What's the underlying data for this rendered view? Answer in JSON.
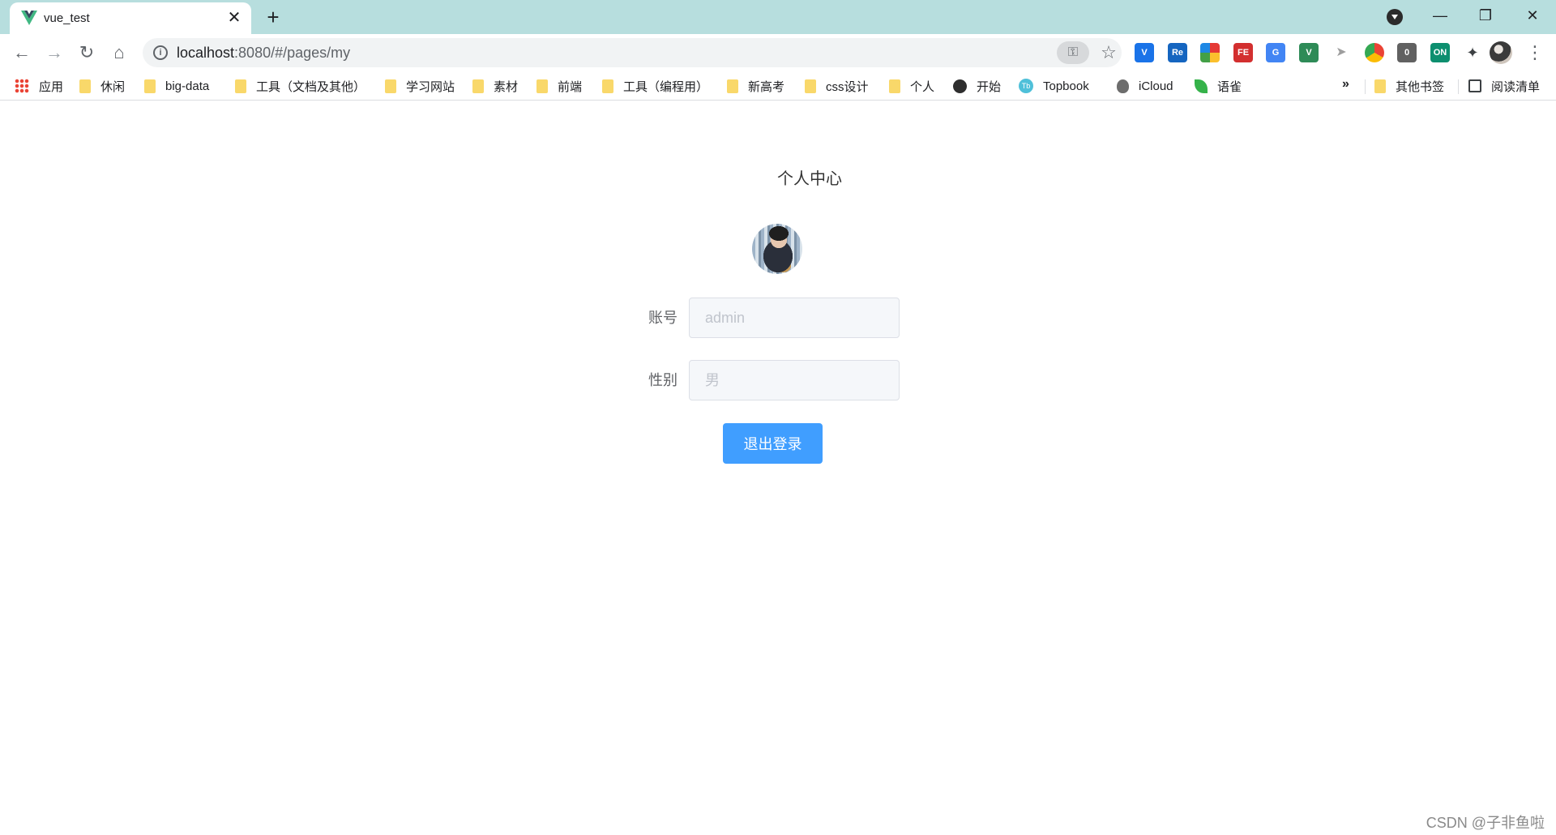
{
  "browser": {
    "tab": {
      "title": "vue_test",
      "close_glyph": "✕"
    },
    "new_tab_glyph": "+",
    "window_controls": {
      "minimize": "—",
      "maximize": "❐",
      "close": "✕"
    },
    "nav": {
      "back": "←",
      "forward": "→",
      "reload": "↻",
      "home": "⌂"
    },
    "address": {
      "host": "localhost",
      "path": ":8080/#/pages/my"
    },
    "bookmarks": [
      {
        "label": "应用",
        "icon": "apps-icon"
      },
      {
        "label": "休闲",
        "icon": "folder-icon"
      },
      {
        "label": "big-data",
        "icon": "folder-icon"
      },
      {
        "label": "工具（文档及其他）",
        "icon": "folder-icon"
      },
      {
        "label": "学习网站",
        "icon": "folder-icon"
      },
      {
        "label": "素材",
        "icon": "folder-icon"
      },
      {
        "label": "前端",
        "icon": "folder-icon"
      },
      {
        "label": "工具（编程用）",
        "icon": "folder-icon"
      },
      {
        "label": "新高考",
        "icon": "folder-icon"
      },
      {
        "label": "css设计",
        "icon": "folder-icon"
      },
      {
        "label": "个人",
        "icon": "folder-icon"
      },
      {
        "label": "开始",
        "icon": "globe-icon"
      },
      {
        "label": "Topbook",
        "icon": "topbook-icon"
      },
      {
        "label": "iCloud",
        "icon": "apple-icon"
      },
      {
        "label": "语雀",
        "icon": "yuque-icon"
      }
    ],
    "bookmarks_overflow": "»",
    "other_bookmarks": "其他书签",
    "reading_list": "阅读清单",
    "extensions": [
      {
        "name": "vue-devtools-icon",
        "text": "V",
        "color": "#1a73e8"
      },
      {
        "name": "regex-icon",
        "text": "Re",
        "color": "#1565c0"
      },
      {
        "name": "color-grid-icon",
        "text": "",
        "color": "#e53935"
      },
      {
        "name": "fe-helper-icon",
        "text": "FE",
        "color": "#d32f2f"
      },
      {
        "name": "translate-icon",
        "text": "G",
        "color": "#4285f4"
      },
      {
        "name": "vue-icon",
        "text": "V",
        "color": "#2e8b57"
      },
      {
        "name": "cursor-icon",
        "text": "➤",
        "color": "#bdbdbd"
      },
      {
        "name": "chromium-icon",
        "text": "",
        "color": "#34a853"
      },
      {
        "name": "badge-icon",
        "text": "0",
        "color": "#616161"
      },
      {
        "name": "on-toggle-icon",
        "text": "ON",
        "color": "#0d8f6f"
      },
      {
        "name": "puzzle-icon",
        "text": "✦",
        "color": "#3c4043"
      }
    ]
  },
  "page": {
    "title": "个人中心",
    "account_label": "账号",
    "account_placeholder": "admin",
    "gender_label": "性别",
    "gender_placeholder": "男",
    "logout_button": "退出登录"
  },
  "watermark": "CSDN @子非鱼啦"
}
